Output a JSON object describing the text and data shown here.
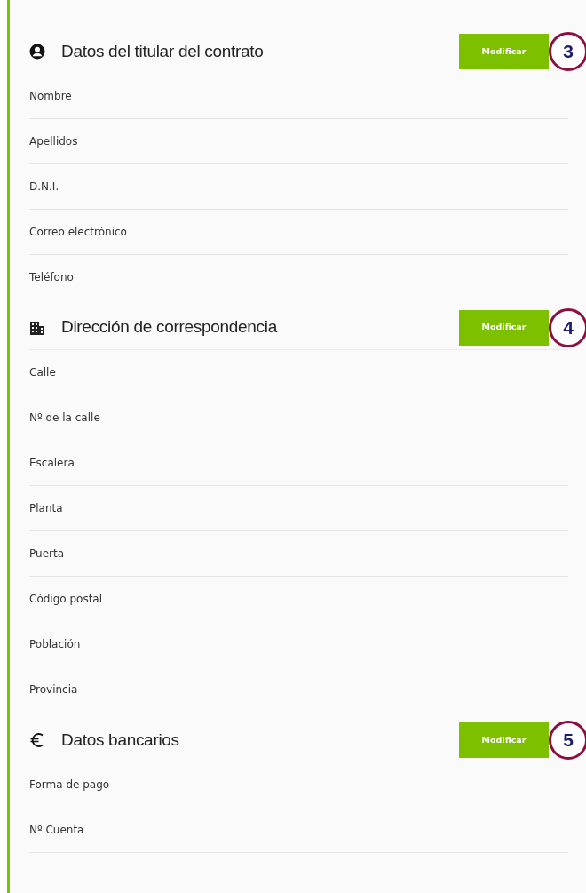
{
  "sections": [
    {
      "title": "Datos del titular del contrato",
      "kind": "user",
      "button": "Modificar",
      "callout": "3",
      "rows": [
        {
          "label": "Nombre",
          "divider": true
        },
        {
          "label": "Apellidos",
          "divider": true
        },
        {
          "label": "D.N.I.",
          "divider": true
        },
        {
          "label": "Correo electrónico",
          "divider": true
        },
        {
          "label": "Teléfono",
          "divider": false
        }
      ]
    },
    {
      "title": "Dirección de correspondencia",
      "kind": "building",
      "button": "Modificar",
      "callout": "4",
      "rows": [
        {
          "label": "Calle",
          "divider": false
        },
        {
          "label": "Nº de la calle",
          "divider": false
        },
        {
          "label": "Escalera",
          "divider": true
        },
        {
          "label": "Planta",
          "divider": true
        },
        {
          "label": "Puerta",
          "divider": true
        },
        {
          "label": "Código postal",
          "divider": false
        },
        {
          "label": "Población",
          "divider": false
        },
        {
          "label": "Provincia",
          "divider": false
        }
      ]
    },
    {
      "title": "Datos bancarios",
      "kind": "euro",
      "button": "Modificar",
      "callout": "5",
      "rows": [
        {
          "label": "Forma de pago",
          "divider": false
        },
        {
          "label": "Nº Cuenta",
          "divider": true
        }
      ]
    }
  ]
}
